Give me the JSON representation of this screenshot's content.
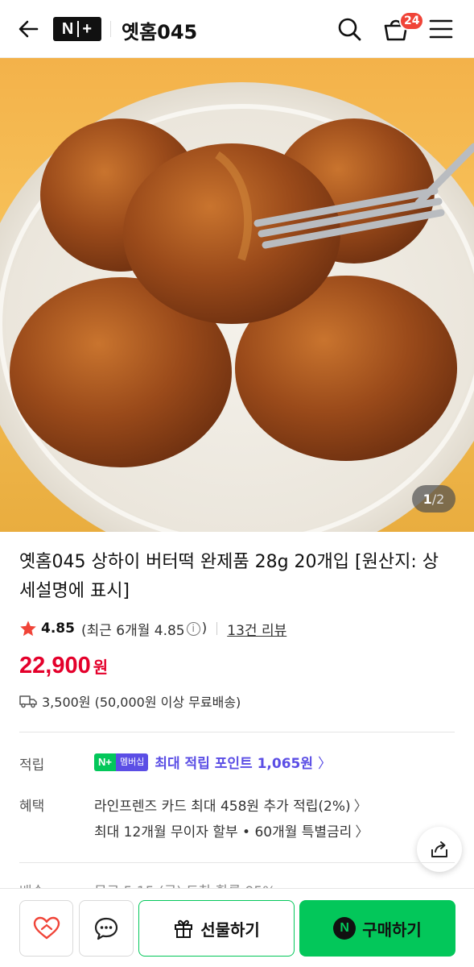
{
  "header": {
    "badge_left": "N",
    "badge_right": "+",
    "brand": "옛홈045",
    "cart_count": "24"
  },
  "hero": {
    "page_current": "1",
    "page_sep": "/",
    "page_total": "2"
  },
  "product": {
    "title": "옛홈045 상하이 버터떡 완제품 28g 20개입 [원산지: 상세설명에 표시]",
    "rating_score": "4.85",
    "rating_recent_prefix": "(최근 6개월 4.85",
    "rating_recent_suffix": ")",
    "info_glyph": "i",
    "review_count": "13건 리뷰",
    "price": "22,900",
    "currency": "원",
    "shipping": "3,500원 (50,000원 이상 무료배송)"
  },
  "details": {
    "points_label": "적립",
    "membership_badge_left": "N+",
    "membership_badge_right": "멤버십",
    "points_text": "최대 적립 포인트 1,065원",
    "benefit_label": "혜택",
    "benefit_line1": "라인프렌즈 카드 최대 458원 추가 적립(2%)",
    "benefit_line2": "최대 12개월 무이자 할부 • 60개월 특별금리",
    "chevron": "〉",
    "partial_label": "배송",
    "partial_value": "무료 5.15 (금) 도착 확률 95%"
  },
  "bottom_bar": {
    "gift_label": "선물하기",
    "buy_icon": "N",
    "buy_label": "구매하기"
  },
  "colors": {
    "price_red": "#e4002b",
    "naver_green": "#03c75a",
    "membership_purple": "#5b4ee5",
    "cart_badge_red": "#f04438"
  },
  "icons": [
    "back-arrow-icon",
    "search-icon",
    "cart-icon",
    "menu-icon",
    "star-icon",
    "info-icon",
    "truck-icon",
    "share-icon",
    "heart-icon",
    "chat-icon",
    "gift-icon"
  ]
}
